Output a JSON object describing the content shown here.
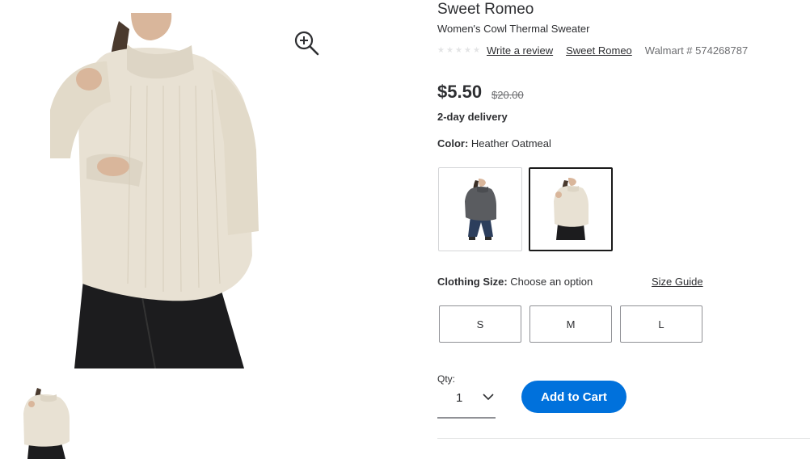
{
  "product": {
    "brand": "Sweet Romeo",
    "title": "Women's Cowl Thermal Sweater",
    "write_review": "Write a review",
    "brand_link": "Sweet Romeo",
    "walmart_number": "Walmart # 574268787",
    "rating_stars": 0
  },
  "pricing": {
    "price": "$5.50",
    "was_price": "$20.00",
    "delivery": "2-day delivery"
  },
  "color": {
    "label": "Color:",
    "selected": "Heather Oatmeal",
    "options": [
      "gray",
      "Heather Oatmeal"
    ]
  },
  "size": {
    "label": "Clothing Size:",
    "value": "Choose an option",
    "guide": "Size Guide",
    "options": [
      "S",
      "M",
      "L"
    ]
  },
  "quantity": {
    "label": "Qty:",
    "value": "1"
  },
  "cart": {
    "button": "Add to Cart"
  },
  "colors": {
    "accent": "#0071dc",
    "sweater": "#e8e1d3",
    "gray_sweater": "#5a5c60",
    "pants": "#1c1c1e"
  },
  "icons": [
    "zoom-in-icon",
    "chevron-down-icon",
    "star-icon"
  ]
}
